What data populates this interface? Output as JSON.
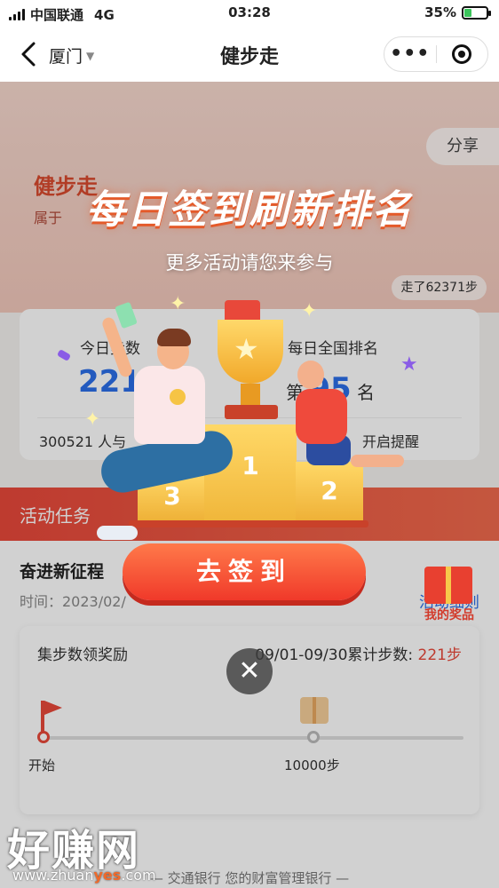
{
  "status_bar": {
    "carrier": "中国联通",
    "network": "4G",
    "time": "03:28",
    "battery": "35%",
    "battery_level": 0.35
  },
  "nav": {
    "city": "厦门",
    "title": "健步走",
    "more_icon": "more-dots-icon",
    "close_icon": "target-icon"
  },
  "banner": {
    "title": "健步走",
    "subtitle": "属于",
    "share": "分享",
    "walked": "走了62371步"
  },
  "steps_card": {
    "today_label": "今日步数",
    "rank_label": "每日全国排名",
    "today_value": "221",
    "rank_prefix": "第",
    "rank_value": "95",
    "rank_suffix": "名",
    "participants": "300521 人与",
    "remind": "开启提醒"
  },
  "tasks": {
    "header": "活动任务",
    "name": "奋进新征程",
    "time": "时间：2023/02/",
    "detail_link": "活动细则",
    "reward_title": "集步数领奖励",
    "reward_period": "09/01-09/30累计步数:",
    "reward_steps": "221步",
    "milestone_start": "开始",
    "milestone_10k": "10000步",
    "my_prize": "我的奖品"
  },
  "footer": {
    "slogan": "— 交通银行 您的财富管理银行 —"
  },
  "popup": {
    "headline": "每日签到刷新排名",
    "subline": "更多活动请您来参与",
    "podium_1": "1",
    "podium_2": "2",
    "podium_3": "3",
    "cta": "去签到",
    "close": "✕"
  },
  "watermark": {
    "big": "好赚网",
    "url_prefix": "www.zhuan",
    "url_highlight": "yes",
    "url_suffix": ".com"
  },
  "colors": {
    "accent_red": "#f0392a",
    "link_blue": "#2b6ee8",
    "gold": "#ffd867"
  }
}
